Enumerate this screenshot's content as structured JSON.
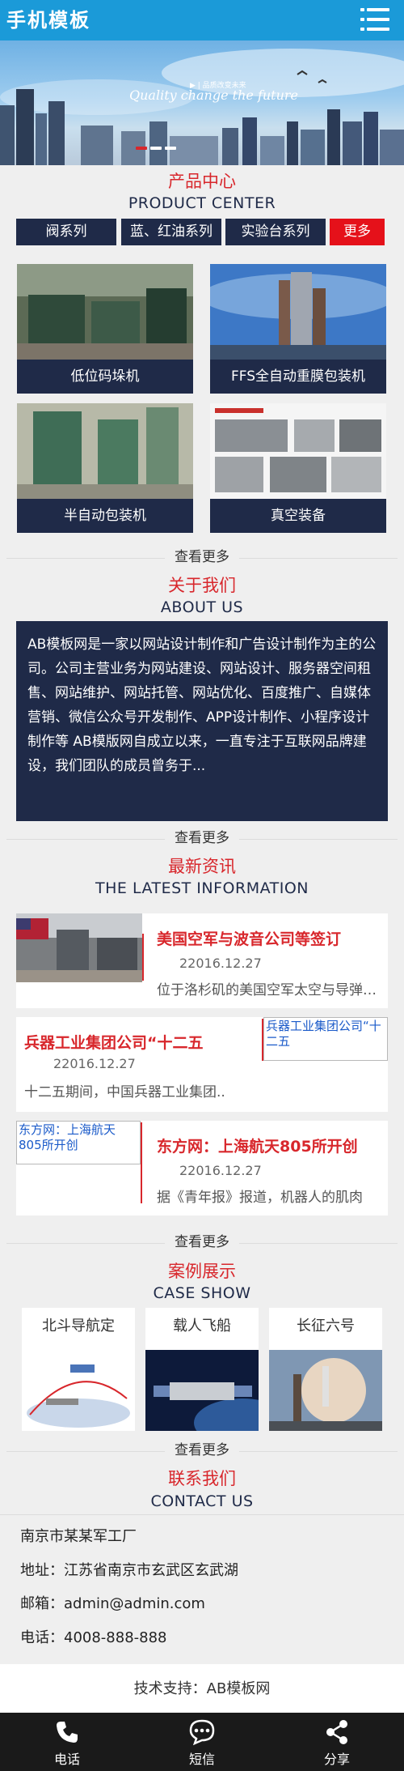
{
  "header": {
    "logo": "手机模板",
    "menu_icon": "menu-icon"
  },
  "banner": {
    "small_text": "▶ | 品质改变未来",
    "main_text": "Quality change the future",
    "slide_count": 3,
    "active_slide": 1
  },
  "products": {
    "title": "产品中心",
    "subtitle": "PRODUCT CENTER",
    "tabs": [
      "阀系列",
      "蓝、红油系列",
      "实验台系列",
      "更多"
    ],
    "items": [
      {
        "label": "低位码垛机"
      },
      {
        "label": "FFS全自动重膜包装机"
      },
      {
        "label": "半自动包装机"
      },
      {
        "label": "真空装备"
      }
    ],
    "more": "查看更多"
  },
  "about": {
    "title": "关于我们",
    "subtitle": "ABOUT US",
    "text": "AB模板网是一家以网站设计制作和广告设计制作为主的公司。公司主营业务为网站建设、网站设计、服务器空间租售、网站维护、网站托管、网站优化、百度推广、自媒体营销、微信公众号开发制作、APP设计制作、小程序设计制作等 AB模版网自成立以来，一直专注于互联网品牌建设，我们团队的成员曾务于...",
    "more": "查看更多"
  },
  "news": {
    "title": "最新资讯",
    "subtitle": "THE LATEST INFORMATION",
    "items": [
      {
        "title": "美国空军与波音公司等签订",
        "date": "22016.12.27",
        "summary": "位于洛杉矶的美国空军太空与导弹系统中心",
        "image_alt": ""
      },
      {
        "title": "兵器工业集团公司“十二五",
        "date": "22016.12.27",
        "summary": "十二五期间，中国兵器工业集团..",
        "image_alt": "兵器工业集团公司“十二五"
      },
      {
        "title": "东方网：上海航天805所开创",
        "date": "22016.12.27",
        "summary": "据《青年报》报道，机器人的肌肉",
        "image_alt": "东方网：上海航天805所开创"
      }
    ],
    "more": "查看更多"
  },
  "cases": {
    "title": "案例展示",
    "subtitle": "CASE SHOW",
    "items": [
      {
        "label": "北斗导航定"
      },
      {
        "label": "载人飞船"
      },
      {
        "label": "长征六号"
      }
    ],
    "more": "查看更多"
  },
  "contact": {
    "title": "联系我们",
    "subtitle": "CONTACT US",
    "company": "南京市某某军工厂",
    "address": "地址：江苏省南京市玄武区玄武湖",
    "email": "邮箱：admin@admin.com",
    "phone": "电话：4008-888-888"
  },
  "support": "技术支持：AB模板网",
  "footer": [
    {
      "label": "电话",
      "icon": "phone-icon"
    },
    {
      "label": "短信",
      "icon": "sms-icon"
    },
    {
      "label": "分享",
      "icon": "share-icon"
    }
  ],
  "colors": {
    "header": "#1b9ad8",
    "navy": "#1f2a48",
    "accent_red": "#d8272c"
  }
}
